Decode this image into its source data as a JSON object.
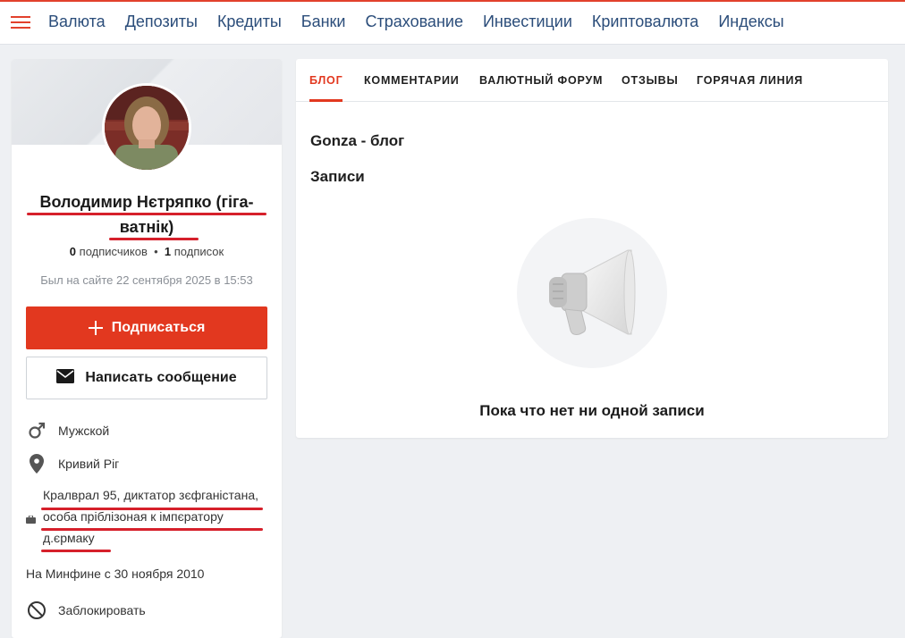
{
  "nav": {
    "items": [
      "Валюта",
      "Депозиты",
      "Кредиты",
      "Банки",
      "Страхование",
      "Инвестиции",
      "Криптовалюта",
      "Индексы"
    ]
  },
  "profile": {
    "name": "Володимир Нєтряпко (гіга-ватнік)",
    "subscribers_count": "0",
    "subscribers_label": "подписчиков",
    "subscriptions_count": "1",
    "subscriptions_label": "подписок",
    "last_seen": "Был на сайте 22 сентября 2025 в 15:53",
    "subscribe_label": "Подписаться",
    "message_label": "Написать сообщение",
    "gender": "Мужской",
    "city": "Кривий Ріг",
    "job": "Кралврал 95, диктатор зєфганістана, особа пріблізоная к імпєратору д.єрмаку",
    "member_since": "На Минфине с 30 ноября 2010",
    "block_label": "Заблокировать"
  },
  "tabs": [
    "БЛОГ",
    "КОММЕНТАРИИ",
    "ВАЛЮТНЫЙ ФОРУМ",
    "ОТЗЫВЫ",
    "ГОРЯЧАЯ ЛИНИЯ"
  ],
  "content": {
    "blog_title": "Gonza - блог",
    "posts_title": "Записи",
    "empty_message": "Пока что нет ни одной записи"
  },
  "colors": {
    "accent": "#e2381f",
    "nav_text": "#2b4d7a",
    "annotation": "#d6202b"
  },
  "icons": [
    "menu-icon",
    "plus-icon",
    "envelope-icon",
    "male-icon",
    "location-pin-icon",
    "briefcase-icon",
    "block-icon",
    "megaphone-icon"
  ]
}
